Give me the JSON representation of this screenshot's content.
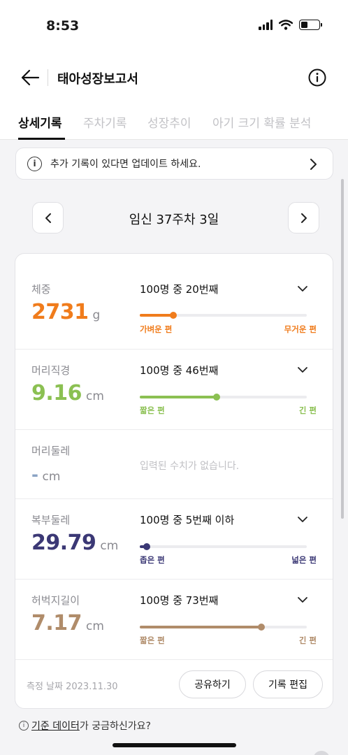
{
  "status_bar": {
    "time": "8:53"
  },
  "header": {
    "title": "태아성장보고서"
  },
  "tabs": [
    {
      "label": "상세기록",
      "active": true
    },
    {
      "label": "주차기록",
      "active": false
    },
    {
      "label": "성장추이",
      "active": false
    },
    {
      "label": "아기 크기 확률 분석",
      "active": false
    }
  ],
  "notice": {
    "icon": "i",
    "text": "추가 기록이 있다면 업데이트 하세요."
  },
  "week": {
    "label": "임신 37주차 3일"
  },
  "measurements": [
    {
      "label": "체중",
      "value": "2731",
      "unit": "g",
      "rank": "100명 중 20번째",
      "percent": 20,
      "low_label": "가벼운 편",
      "high_label": "무거운 편",
      "color": "#f07c1c"
    },
    {
      "label": "머리직경",
      "value": "9.16",
      "unit": "cm",
      "rank": "100명 중 46번째",
      "percent": 46,
      "low_label": "짧은 편",
      "high_label": "긴 편",
      "color": "#8bc052"
    },
    {
      "label": "머리둘레",
      "value": "-",
      "unit": "cm",
      "empty_text": "입력된 수치가 없습니다.",
      "color": "#8aa3c4"
    },
    {
      "label": "복부둘레",
      "value": "29.79",
      "unit": "cm",
      "rank": "100명 중 5번째 이하",
      "percent": 4,
      "low_label": "좁은 편",
      "high_label": "넓은 편",
      "color": "#3b3875"
    },
    {
      "label": "허벅지길이",
      "value": "7.17",
      "unit": "cm",
      "rank": "100명 중 73번째",
      "percent": 73,
      "low_label": "짧은 편",
      "high_label": "긴 편",
      "color": "#b08c6a"
    }
  ],
  "footer": {
    "date": "측정 날짜 2023.11.30",
    "share_label": "공유하기",
    "edit_label": "기록 편집"
  },
  "bottom_link": {
    "icon": "i",
    "link_text": "기준 데이터",
    "suffix": "가 궁금하신가요?"
  }
}
